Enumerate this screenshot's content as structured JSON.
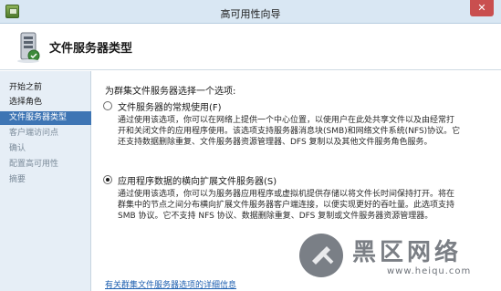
{
  "window": {
    "title": "高可用性向导",
    "close_glyph": "✕"
  },
  "header": {
    "title": "文件服务器类型",
    "icon": "server-icon"
  },
  "sidebar": {
    "items": [
      {
        "label": "开始之前",
        "state": "done"
      },
      {
        "label": "选择角色",
        "state": "done"
      },
      {
        "label": "文件服务器类型",
        "state": "active"
      },
      {
        "label": "客户端访问点",
        "state": "disabled"
      },
      {
        "label": "确认",
        "state": "disabled"
      },
      {
        "label": "配置高可用性",
        "state": "disabled"
      },
      {
        "label": "摘要",
        "state": "disabled"
      }
    ]
  },
  "main": {
    "prompt": "为群集文件服务器选择一个选项:",
    "options": [
      {
        "label": "文件服务器的常规使用(F)",
        "selected": false,
        "description": [
          "通过使用该选项，你可以在网络上提供一个中心位置，以使用户在此处共享文件以及由经常打",
          "开和关闭文件的应用程序使用。该选项支持服务器消息块(SMB)和网络文件系统(NFS)协议。它",
          "还支持数据删除重复、文件服务器资源管理器、DFS 复制以及其他文件服务角色服务。"
        ]
      },
      {
        "label": "应用程序数据的横向扩展文件服务器(S)",
        "selected": true,
        "description": [
          "通过使用该选项，你可以为服务器应用程序或虚拟机提供存储以将文件长时间保持打开。将在",
          "群集中的节点之间分布横向扩展文件服务器客户端连接，以便实现更好的吞吐量。此选项支持",
          "SMB 协议。它不支持 NFS 协议、数据删除重复、DFS 复制或文件服务器资源管理器。"
        ]
      }
    ],
    "help_link": "有关群集文件服务器选项的详细信息"
  },
  "watermark": {
    "text": "黑区网络",
    "url": "www.heiqu.com",
    "color": "#7b7f85"
  },
  "colors": {
    "titlebar": "#d9e7f3",
    "sidebar": "#e6eef6",
    "selection": "#3e75b4",
    "link": "#1e5fb0"
  }
}
